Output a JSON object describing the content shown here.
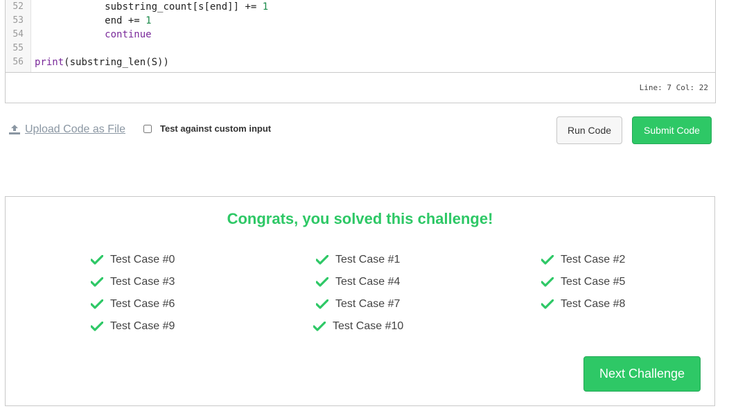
{
  "editor": {
    "lines": [
      {
        "number": "52",
        "indent": "            ",
        "parts": [
          {
            "t": "substring_count[s[end]] += ",
            "c": ""
          },
          {
            "t": "1",
            "c": "num"
          }
        ]
      },
      {
        "number": "53",
        "indent": "            ",
        "parts": [
          {
            "t": "end += ",
            "c": ""
          },
          {
            "t": "1",
            "c": "num"
          }
        ]
      },
      {
        "number": "54",
        "indent": "            ",
        "parts": [
          {
            "t": "continue",
            "c": "kw"
          }
        ]
      },
      {
        "number": "55",
        "indent": "",
        "parts": []
      },
      {
        "number": "56",
        "indent": "",
        "parts": [
          {
            "t": "print",
            "c": "kw"
          },
          {
            "t": "(substring_len(S))",
            "c": ""
          }
        ]
      }
    ],
    "cursor_position": "Line: 7 Col: 22"
  },
  "toolbar": {
    "upload_label": "Upload Code as File",
    "custom_input_label": "Test against custom input",
    "run_label": "Run Code",
    "submit_label": "Submit Code"
  },
  "results": {
    "message": "Congrats, you solved this challenge!",
    "test_cases": [
      "Test Case #0",
      "Test Case #1",
      "Test Case #2",
      "Test Case #3",
      "Test Case #4",
      "Test Case #5",
      "Test Case #6",
      "Test Case #7",
      "Test Case #8",
      "Test Case #9",
      "Test Case #10"
    ],
    "next_label": "Next Challenge"
  },
  "colors": {
    "accent": "#2ec866"
  }
}
